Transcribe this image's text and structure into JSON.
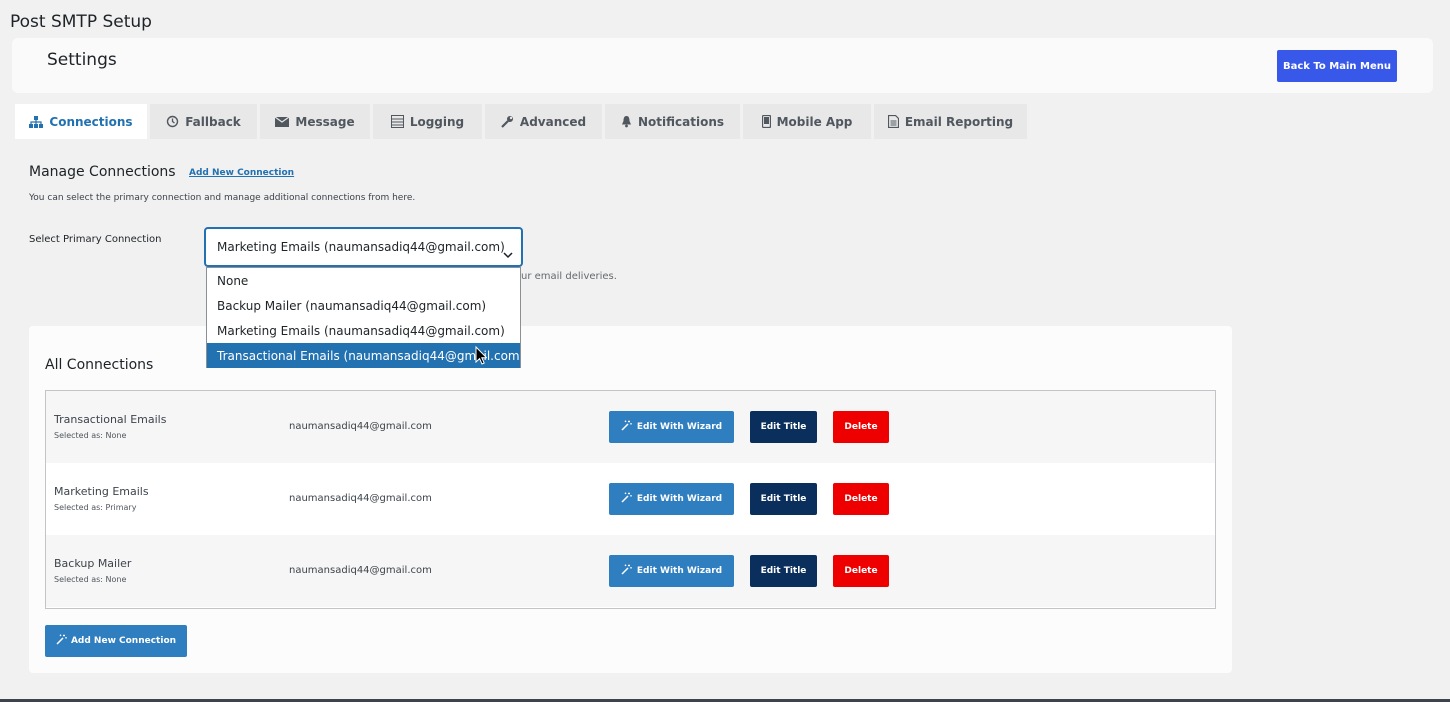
{
  "page": {
    "title": "Post SMTP Setup"
  },
  "header": {
    "title": "Settings",
    "back_button": "Back To Main Menu"
  },
  "tabs": [
    {
      "label": "Connections",
      "icon": "sitemap-icon",
      "active": true
    },
    {
      "label": "Fallback",
      "icon": "history-icon"
    },
    {
      "label": "Message",
      "icon": "envelope-icon"
    },
    {
      "label": "Logging",
      "icon": "list-icon"
    },
    {
      "label": "Advanced",
      "icon": "wrench-icon"
    },
    {
      "label": "Notifications",
      "icon": "bell-icon"
    },
    {
      "label": "Mobile App",
      "icon": "mobile-icon"
    },
    {
      "label": "Email Reporting",
      "icon": "document-icon"
    }
  ],
  "manage": {
    "title": "Manage Connections",
    "add_link": "Add New Connection",
    "description": "You can select the primary connection and manage additional connections from here.",
    "select_label": "Select Primary Connection",
    "selected_value": "Marketing Emails (naumansadiq44@gmail.com)",
    "hint_visible": "ur email deliveries.",
    "options": [
      "None",
      "Backup Mailer (naumansadiq44@gmail.com)",
      "Marketing Emails (naumansadiq44@gmail.com)",
      "Transactional Emails (naumansadiq44@gmail.com)"
    ],
    "highlighted_option_index": 3
  },
  "connections": {
    "title": "All Connections",
    "rows": [
      {
        "name": "Transactional Emails",
        "selected_as": "Selected as: None",
        "email": "naumansadiq44@gmail.com"
      },
      {
        "name": "Marketing Emails",
        "selected_as": "Selected as: Primary",
        "email": "naumansadiq44@gmail.com"
      },
      {
        "name": "Backup Mailer",
        "selected_as": "Selected as: None",
        "email": "naumansadiq44@gmail.com"
      }
    ],
    "buttons": {
      "wizard": "Edit With Wizard",
      "edit_title": "Edit Title",
      "delete": "Delete"
    },
    "add_button": "Add New Connection"
  },
  "colors": {
    "primary_blue": "#3858e9",
    "link_blue": "#2271b1",
    "wizard_blue": "#2e7ec0",
    "navy": "#0a2f5c",
    "delete_red": "#ee0000"
  }
}
